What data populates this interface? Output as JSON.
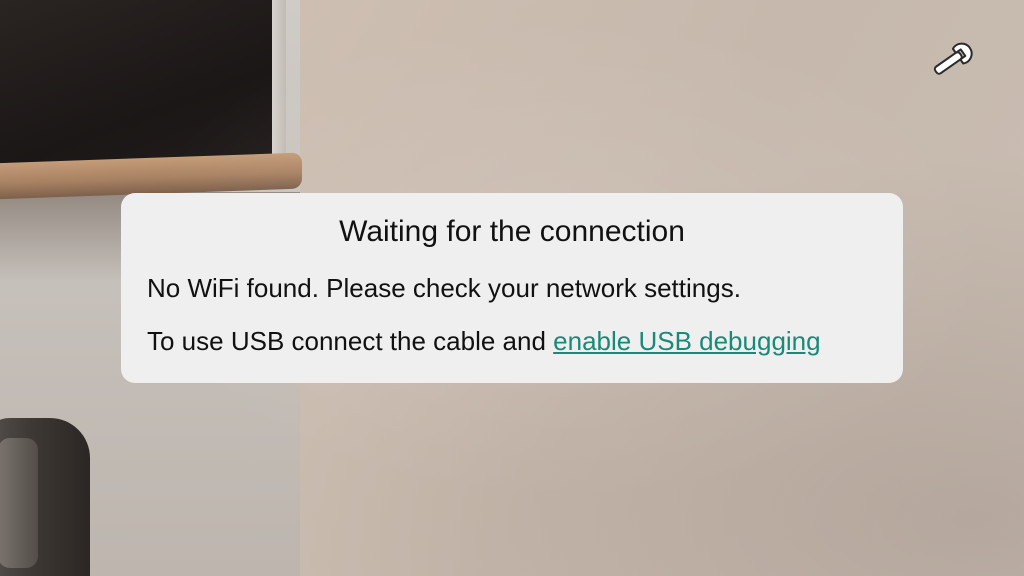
{
  "dialog": {
    "title": "Waiting for the connection",
    "wifi_message": "No WiFi found. Please check your network settings.",
    "usb_message": "To use USB connect the cable and ",
    "usb_link": "enable USB debugging"
  },
  "toolbar": {
    "settings_icon": "wrench-icon"
  },
  "colors": {
    "dialog_background": "#efefef",
    "link": "#1a8a78",
    "text": "#111111"
  }
}
